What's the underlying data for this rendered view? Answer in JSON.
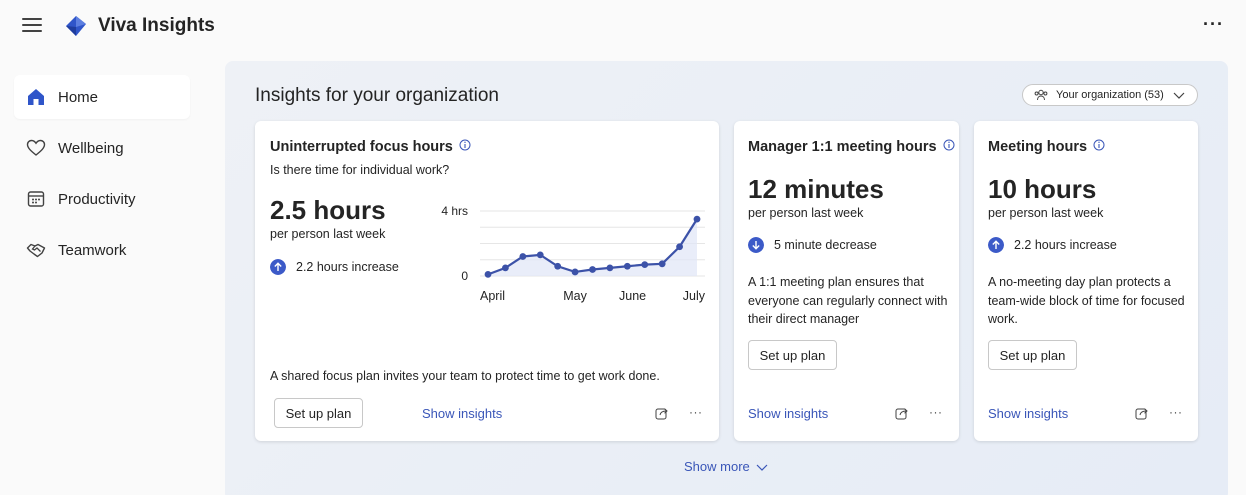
{
  "app": {
    "title": "Viva Insights",
    "more": "···"
  },
  "icons": {
    "menu": "hamburger-icon",
    "logo": "viva-insights-logo",
    "more": "more-options-icon"
  },
  "sidebar": {
    "items": [
      {
        "label": "Home",
        "icon": "home-icon",
        "active": true
      },
      {
        "label": "Wellbeing",
        "icon": "heart-icon",
        "active": false
      },
      {
        "label": "Productivity",
        "icon": "calendar-icon",
        "active": false
      },
      {
        "label": "Teamwork",
        "icon": "handshake-icon",
        "active": false
      }
    ]
  },
  "main": {
    "title": "Insights for your organization",
    "org_selector": "Your organization (53)",
    "show_more": "Show more"
  },
  "cards": {
    "focus": {
      "title": "Uninterrupted focus hours",
      "question": "Is there time for individual work?",
      "value": "2.5 hours",
      "per": "per person last week",
      "trend": "2.2 hours increase",
      "trend_direction": "up",
      "description": "A shared focus plan invites your team to protect time to get work done.",
      "button": "Set up plan",
      "link": "Show insights",
      "more": "···"
    },
    "manager": {
      "title": "Manager 1:1 meeting hours",
      "value": "12 minutes",
      "per": "per person last week",
      "trend": "5 minute decrease",
      "trend_direction": "down",
      "description": "A 1:1 meeting plan ensures that everyone can regularly connect with their direct manager",
      "button": "Set up plan",
      "link": "Show insights",
      "more": "···"
    },
    "meeting": {
      "title": "Meeting hours",
      "value": "10 hours",
      "per": "per person last week",
      "trend": "2.2 hours increase",
      "trend_direction": "up",
      "description": "A no-meeting day plan protects a team-wide block of time for focused work.",
      "button": "Set up plan",
      "link": "Show insights",
      "more": "···"
    }
  },
  "colors": {
    "accent": "#3a56b8",
    "line": "#3c52a8",
    "trend_dot": "#3c5ac8"
  },
  "chart_data": {
    "type": "line",
    "ylim": [
      0,
      4
    ],
    "y_ticks": [
      "4 hrs",
      "0"
    ],
    "x_ticks": [
      "April",
      "May",
      "June",
      "July"
    ],
    "series": [
      {
        "values": [
          0.1,
          0.5,
          1.2,
          1.3,
          0.6,
          0.25,
          0.4,
          0.5,
          0.6,
          0.7,
          0.75,
          1.8,
          3.5
        ]
      }
    ]
  }
}
